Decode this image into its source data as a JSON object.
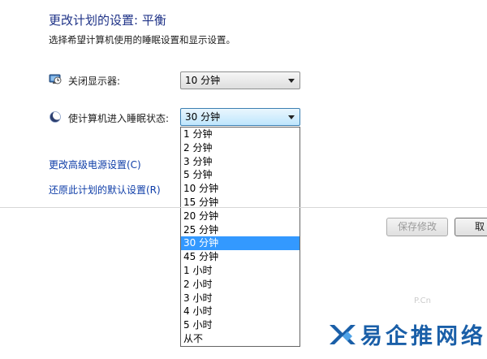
{
  "header": {
    "title": "更改计划的设置: 平衡",
    "subtitle": "选择希望计算机使用的睡眠设置和显示设置。"
  },
  "settings": {
    "display_off": {
      "label": "关闭显示器:",
      "value": "10 分钟",
      "icon": "monitor-clock-icon"
    },
    "sleep": {
      "label": "使计算机进入睡眠状态:",
      "value": "30 分钟",
      "icon": "moon-icon"
    }
  },
  "sleep_options": [
    "1 分钟",
    "2 分钟",
    "3 分钟",
    "5 分钟",
    "10 分钟",
    "15 分钟",
    "20 分钟",
    "25 分钟",
    "30 分钟",
    "45 分钟",
    "1 小时",
    "2 小时",
    "3 小时",
    "4 小时",
    "5 小时",
    "从不"
  ],
  "selected_option_index": 8,
  "links": {
    "advanced": "更改高级电源设置(C)",
    "restore": "还原此计划的默认设置(R)"
  },
  "buttons": {
    "save": "保存修改",
    "cancel": "取"
  },
  "watermark": {
    "text": "易企推网络",
    "faint": "P.Cn"
  },
  "colors": {
    "accent": "#3399ff",
    "title": "#1e3287",
    "link": "#0f3ea8",
    "brand": "#1a5fa8"
  }
}
